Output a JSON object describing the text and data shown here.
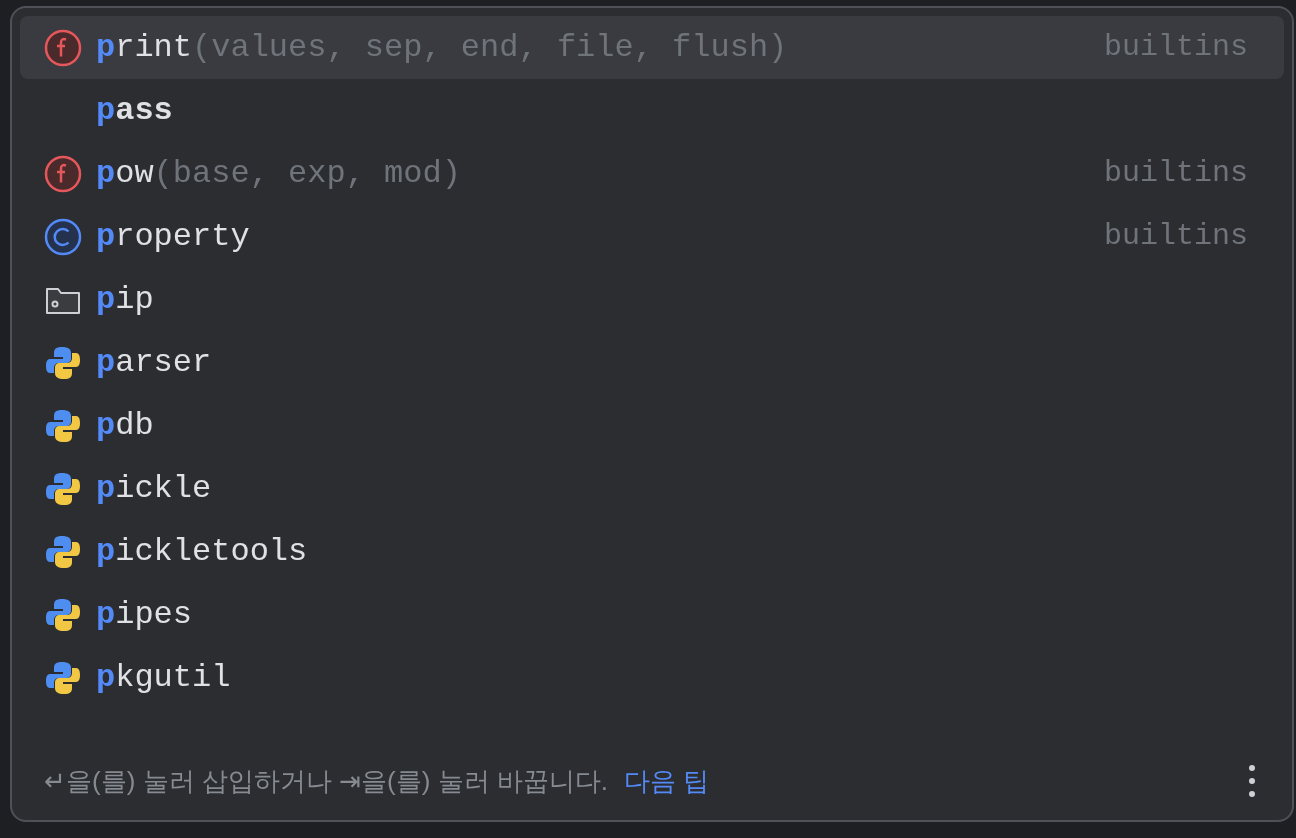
{
  "completion_list": {
    "items": [
      {
        "kind": "function",
        "match": "p",
        "rest": "rint",
        "params": "(values, sep, end, file, flush)",
        "source": "builtins",
        "selected": true
      },
      {
        "kind": "keyword",
        "match": "p",
        "rest": "ass",
        "selected": false
      },
      {
        "kind": "function",
        "match": "p",
        "rest": "ow",
        "params": "(base, exp, mod)",
        "source": "builtins",
        "selected": false
      },
      {
        "kind": "class",
        "match": "p",
        "rest": "roperty",
        "source": "builtins",
        "selected": false
      },
      {
        "kind": "package",
        "match": "p",
        "rest": "ip",
        "selected": false
      },
      {
        "kind": "module",
        "match": "p",
        "rest": "arser",
        "selected": false
      },
      {
        "kind": "module",
        "match": "p",
        "rest": "db",
        "selected": false
      },
      {
        "kind": "module",
        "match": "p",
        "rest": "ickle",
        "selected": false
      },
      {
        "kind": "module",
        "match": "p",
        "rest": "ickletools",
        "selected": false
      },
      {
        "kind": "module",
        "match": "p",
        "rest": "ipes",
        "selected": false
      },
      {
        "kind": "module",
        "match": "p",
        "rest": "kgutil",
        "selected": false
      }
    ]
  },
  "footer": {
    "hint": "↵을(를) 눌러 삽입하거나 ⇥을(를) 눌러 바꿉니다.",
    "link": "다음 팁"
  }
}
